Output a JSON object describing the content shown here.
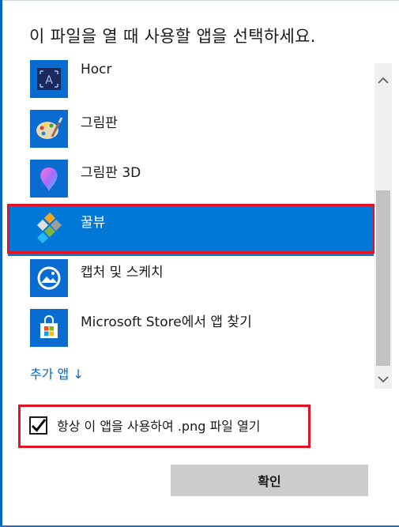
{
  "dialog": {
    "title": "이 파일을 열 때 사용할 앱을 선택하세요."
  },
  "apps": [
    {
      "label": "Hocr",
      "icon": "hocr-icon"
    },
    {
      "label": "그림판",
      "icon": "paint-palette-icon"
    },
    {
      "label": "그림판 3D",
      "icon": "paint-3d-icon"
    },
    {
      "label": "꿀뷰",
      "icon": "honeyview-icon",
      "selected": true
    },
    {
      "label": "캡처 및 스케치",
      "icon": "snip-sketch-icon"
    },
    {
      "label": "Microsoft Store에서 앱 찾기",
      "icon": "microsoft-store-icon"
    }
  ],
  "more_apps_link": "추가 앱 ↓",
  "always_use": {
    "label": "항상 이 앱을 사용하여 .png 파일 열기",
    "checked": true
  },
  "ok_button": "확인",
  "colors": {
    "accent": "#0078d7",
    "tile": "#0a6bd0",
    "highlight": "#e81123",
    "link": "#0a64c8"
  }
}
